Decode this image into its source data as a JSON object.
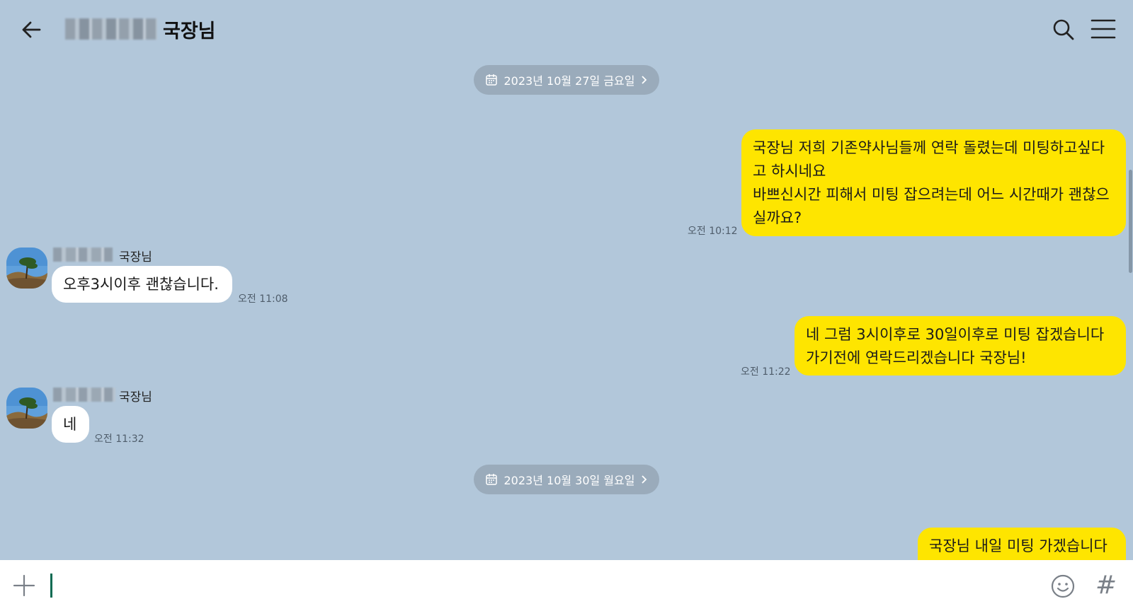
{
  "header": {
    "title": "국장님"
  },
  "dates": [
    {
      "label": "2023년 10월 27일 금요일"
    },
    {
      "label": "2023년 10월 30일 월요일"
    }
  ],
  "messages": [
    {
      "from": "me",
      "text": "국장님 저희 기존약사님들께 연락 돌렸는데 미팅하고싶다\n고 하시네요\n바쁘신시간 피해서 미팅 잡으려는데 어느 시간때가 괜찮으\n실까요?",
      "time": "오전 10:12"
    },
    {
      "from": "other",
      "sender": "국장님",
      "text": "오후3시이후 괜찮습니다.",
      "time": "오전 11:08"
    },
    {
      "from": "me",
      "text": "네 그럼 3시이후로  30일이후로 미팅 잡겠습니다\n가기전에 연락드리겠습니다 국장님!",
      "time": "오전 11:22"
    },
    {
      "from": "other",
      "sender": "국장님",
      "text": "네",
      "time": "오전 11:32"
    },
    {
      "from": "me",
      "text": "국장님 내일 미팅 가겠습니다"
    }
  ],
  "icons": {
    "back": "arrow-left-icon",
    "search": "search-icon",
    "menu": "hamburger-menu-icon",
    "calendar": "calendar-icon",
    "plus": "plus-icon",
    "emoji": "emoji-icon",
    "hashtag": "hashtag-icon"
  },
  "colors": {
    "background": "#b2c7da",
    "my_bubble": "#fee500",
    "other_bubble": "#ffffff",
    "date_pill": "#9aabbb"
  }
}
